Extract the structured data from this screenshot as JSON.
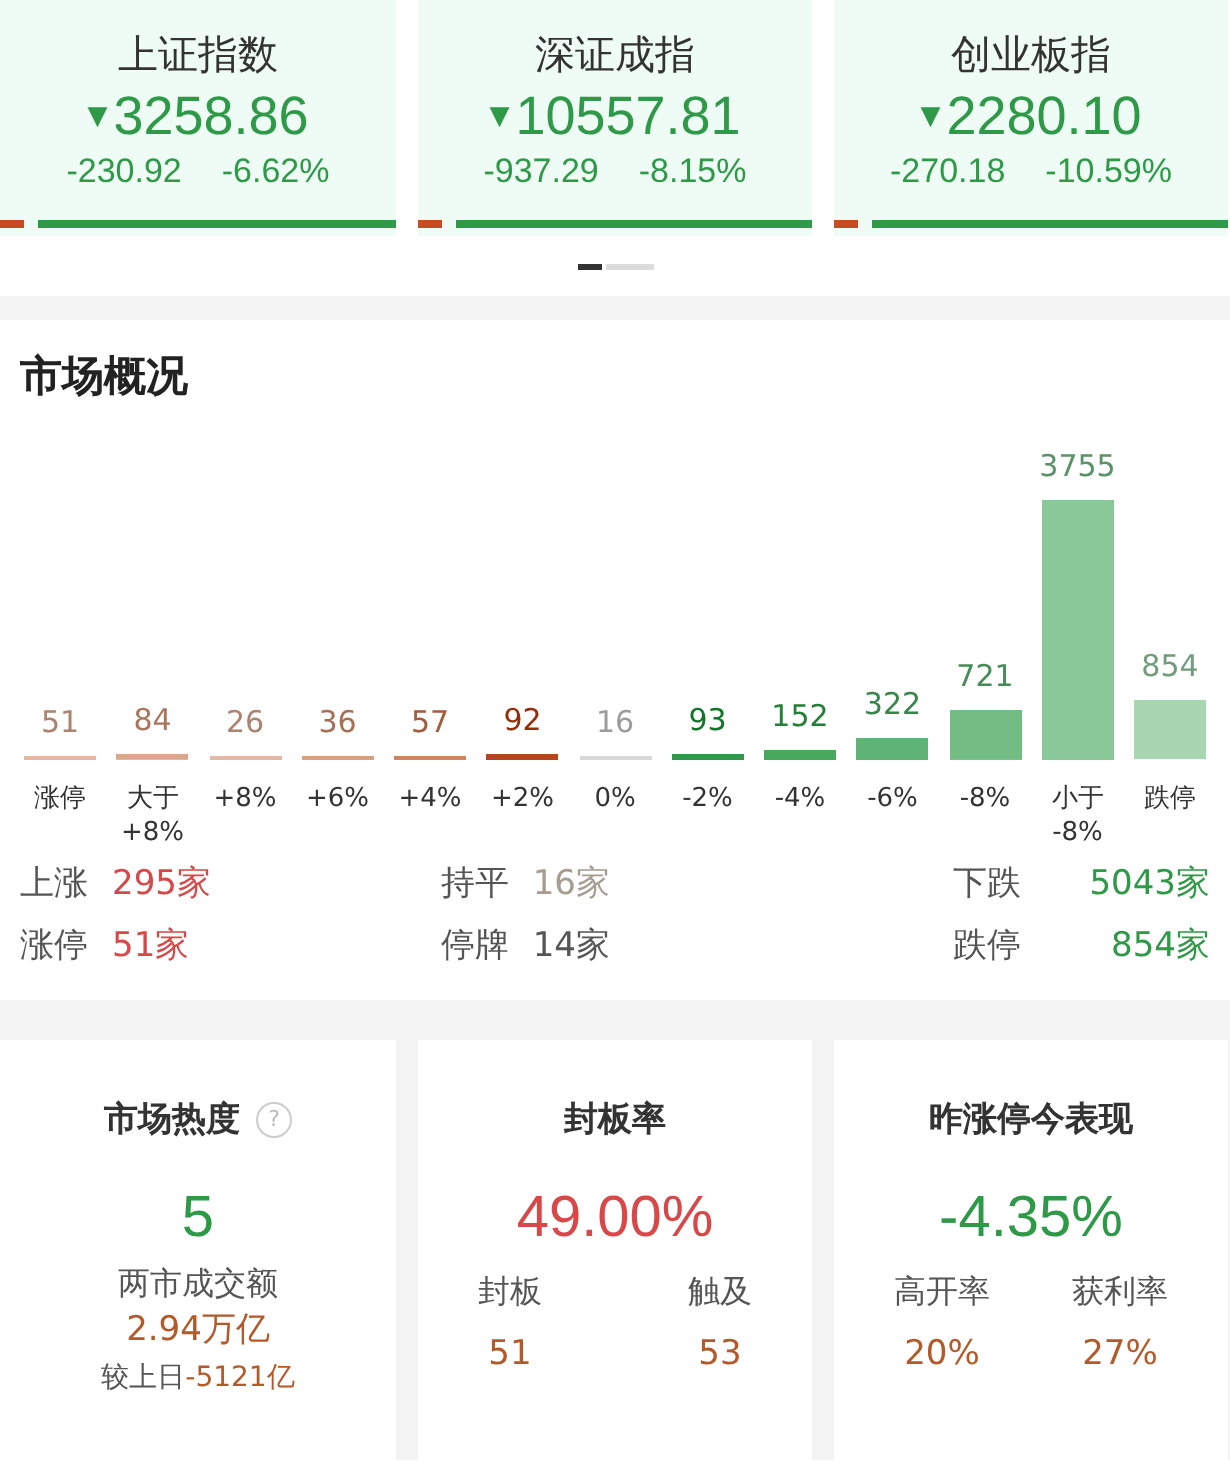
{
  "indices": [
    {
      "name": "上证指数",
      "arrow": "▼",
      "value": "3258.86",
      "change": "-230.92",
      "percent": "-6.62%",
      "level": 0.06
    },
    {
      "name": "深证成指",
      "arrow": "▼",
      "value": "10557.81",
      "change": "-937.29",
      "percent": "-8.15%",
      "level": 0.06
    },
    {
      "name": "创业板指",
      "arrow": "▼",
      "value": "2280.10",
      "change": "-270.18",
      "percent": "-10.59%",
      "level": 0.06
    }
  ],
  "pager": [
    {
      "selected": true
    },
    {
      "selected": false
    }
  ],
  "market": {
    "title": "市场概况",
    "chart_data": {
      "type": "bar",
      "categories": [
        "涨停",
        "大于\n+8%",
        "+8%",
        "+6%",
        "+4%",
        "+2%",
        "0%",
        "-2%",
        "-4%",
        "-6%",
        "-8%",
        "小于\n-8%",
        "跌停"
      ],
      "values": [
        51,
        84,
        26,
        36,
        57,
        92,
        16,
        93,
        152,
        322,
        721,
        3755,
        854
      ],
      "colors": [
        "#e6b8a2",
        "#dea68a",
        "#e3b9a5",
        "#d99f82",
        "#cf8560",
        "#b4461f",
        "#d8d8d8",
        "#2e9a48",
        "#47a85e",
        "#5fb374",
        "#73bd85",
        "#8ac799",
        "#a8d6b2"
      ],
      "data_labels": true
    },
    "stats": [
      {
        "label": "上涨",
        "value": "295家",
        "color": "#d94848"
      },
      {
        "label": "持平",
        "value": "16家",
        "color": "#a59d90"
      },
      {
        "label": "下跌",
        "value": "5043家",
        "color": "#2e9a48"
      },
      {
        "label": "涨停",
        "value": "51家",
        "color": "#d94848"
      },
      {
        "label": "停牌",
        "value": "14家",
        "color": "#555555"
      },
      {
        "label": "跌停",
        "value": "854家",
        "color": "#2e9a48"
      }
    ]
  },
  "heat": {
    "title": "市场热度",
    "help": "?",
    "value": "5",
    "turnover_label": "两市成交额",
    "turnover": "2.94万亿",
    "compare_label": "较上日",
    "compare": "-5121亿"
  },
  "seal": {
    "title": "封板率",
    "value": "49.00%",
    "items": [
      {
        "label": "封板",
        "value": "51"
      },
      {
        "label": "触及",
        "value": "53"
      }
    ]
  },
  "yesterday": {
    "title": "昨涨停今表现",
    "value": "-4.35%",
    "items": [
      {
        "label": "高开率",
        "value": "20%"
      },
      {
        "label": "获利率",
        "value": "27%"
      }
    ]
  }
}
